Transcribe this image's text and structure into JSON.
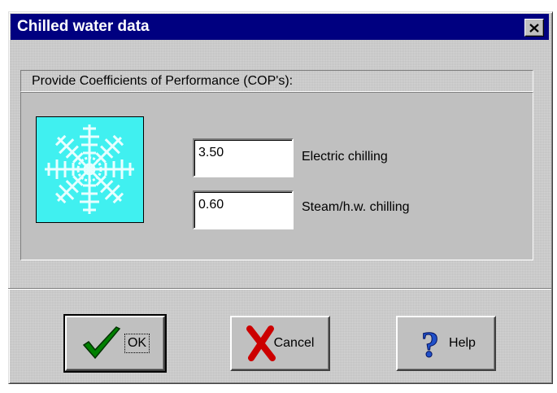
{
  "window": {
    "title": "Chilled water data",
    "close_label": "×"
  },
  "group": {
    "label": "Provide Coefficients of Performance (COP's):"
  },
  "fields": {
    "electric": {
      "value": "3.50",
      "label": "Electric chilling"
    },
    "steam": {
      "value": "0.60",
      "label": "Steam/h.w. chilling"
    }
  },
  "buttons": {
    "ok": "OK",
    "cancel": "Cancel",
    "help": "Help"
  },
  "icons": {
    "picture": "snowflake-icon",
    "ok": "checkmark-icon",
    "cancel": "x-icon",
    "help": "question-icon"
  },
  "colors": {
    "titlebar": "#000080",
    "picture_bg": "#40f0f0",
    "check": "#008000",
    "x": "#cc0000",
    "help": "#2050c8"
  }
}
